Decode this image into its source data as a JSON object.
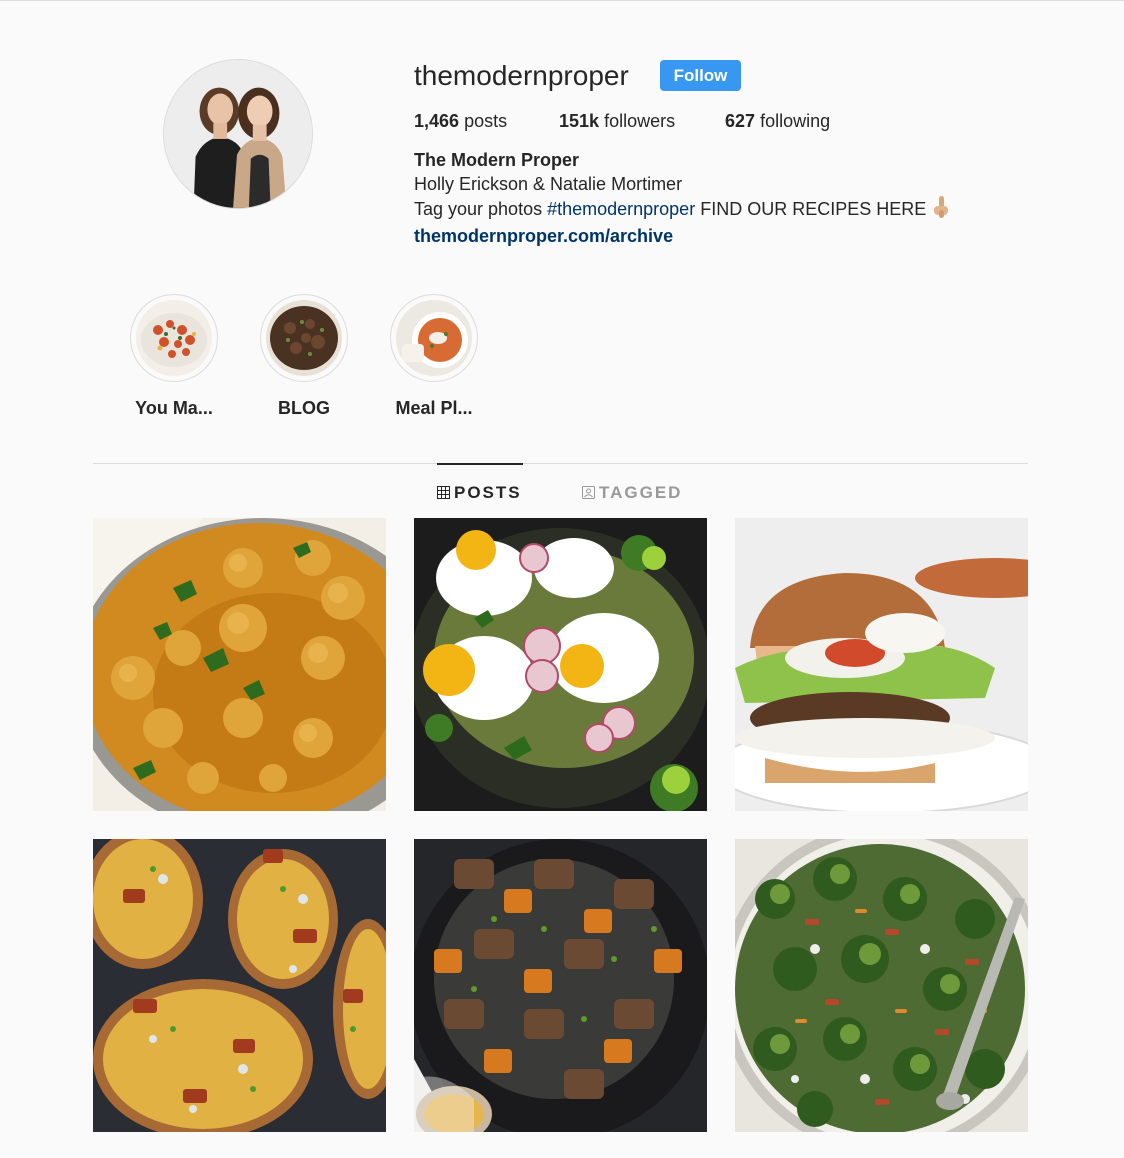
{
  "profile": {
    "username": "themodernproper",
    "follow_label": "Follow",
    "stats": [
      {
        "count": "1,466",
        "label": "posts"
      },
      {
        "count": "151k",
        "label": "followers"
      },
      {
        "count": "627",
        "label": "following"
      }
    ],
    "bio": {
      "name": "The Modern Proper",
      "line1": "Holly Erickson & Natalie Mortimer",
      "line2_prefix": "Tag your photos ",
      "hashtag": "#themodernproper",
      "line2_suffix": " FIND OUR RECIPES HERE",
      "emoji_icon": "pointing-down-hand-icon",
      "link": "themodernproper.com/archive"
    }
  },
  "highlights": [
    {
      "label": "You Ma..."
    },
    {
      "label": "BLOG"
    },
    {
      "label": "Meal Pl..."
    }
  ],
  "tabs": [
    {
      "label": "POSTS",
      "icon": "grid-icon",
      "active": true
    },
    {
      "label": "TAGGED",
      "icon": "tagged-icon",
      "active": false
    }
  ],
  "colors": {
    "accent": "#3897f0",
    "link": "#003569",
    "text": "#262626",
    "muted": "#999999",
    "background": "#fafafa"
  }
}
